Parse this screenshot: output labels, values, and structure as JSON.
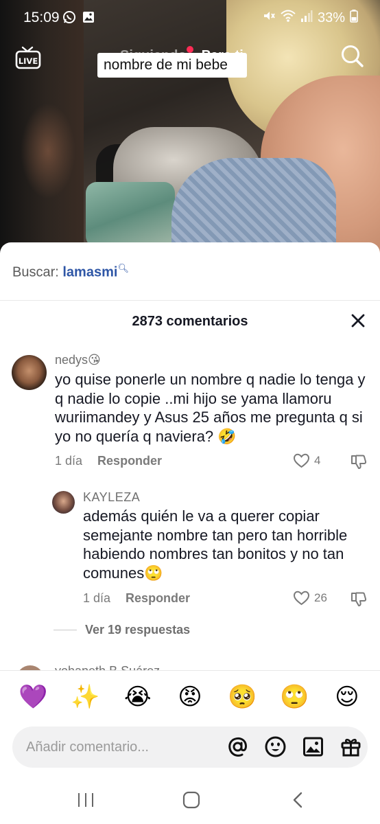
{
  "status_bar": {
    "time": "15:09",
    "battery": "33%",
    "icons_left": [
      "whatsapp-icon",
      "image-icon"
    ],
    "icons_right": [
      "mute-icon",
      "wifi-icon",
      "signal-icon",
      "battery-icon"
    ]
  },
  "top_nav": {
    "live_label": "LIVE",
    "tabs": [
      {
        "label": "Siguiendo",
        "active": false
      },
      {
        "label": "Para ti",
        "active": true
      }
    ]
  },
  "video": {
    "caption_sticker": "nombre de mi bebe"
  },
  "search_suggestion": {
    "prefix": "Buscar:",
    "term": "lamasmi"
  },
  "comments": {
    "header": "2873 comentarios",
    "items": [
      {
        "username": "nedys😘",
        "text": "yo quise ponerle un nombre q nadie lo tenga y q nadie lo copie ..mi hijo se yama llamoru wuriimandey y Asus 25 años me pregunta q si yo no quería q naviera? 🤣",
        "time": "1 día",
        "reply_label": "Responder",
        "likes": "4"
      },
      {
        "username": "KAYLEZA",
        "text": "además quién le va a querer copiar semejante nombre tan pero tan horrible habiendo nombres tan bonitos y no tan comunes🙄",
        "time": "1 día",
        "reply_label": "Responder",
        "likes": "26"
      }
    ],
    "view_replies": "Ver 19 respuestas",
    "next_username_partial": "yohaneth B Suárez"
  },
  "emoji_bar": [
    "💜",
    "✨",
    "😭",
    "😡",
    "🥺",
    "🙄",
    "😌"
  ],
  "comment_input": {
    "placeholder": "Añadir comentario..."
  },
  "colors": {
    "accent_red": "#fe2c55",
    "link_blue": "#2e56a6",
    "text_primary": "#161823",
    "text_secondary": "#7a7a7a"
  }
}
